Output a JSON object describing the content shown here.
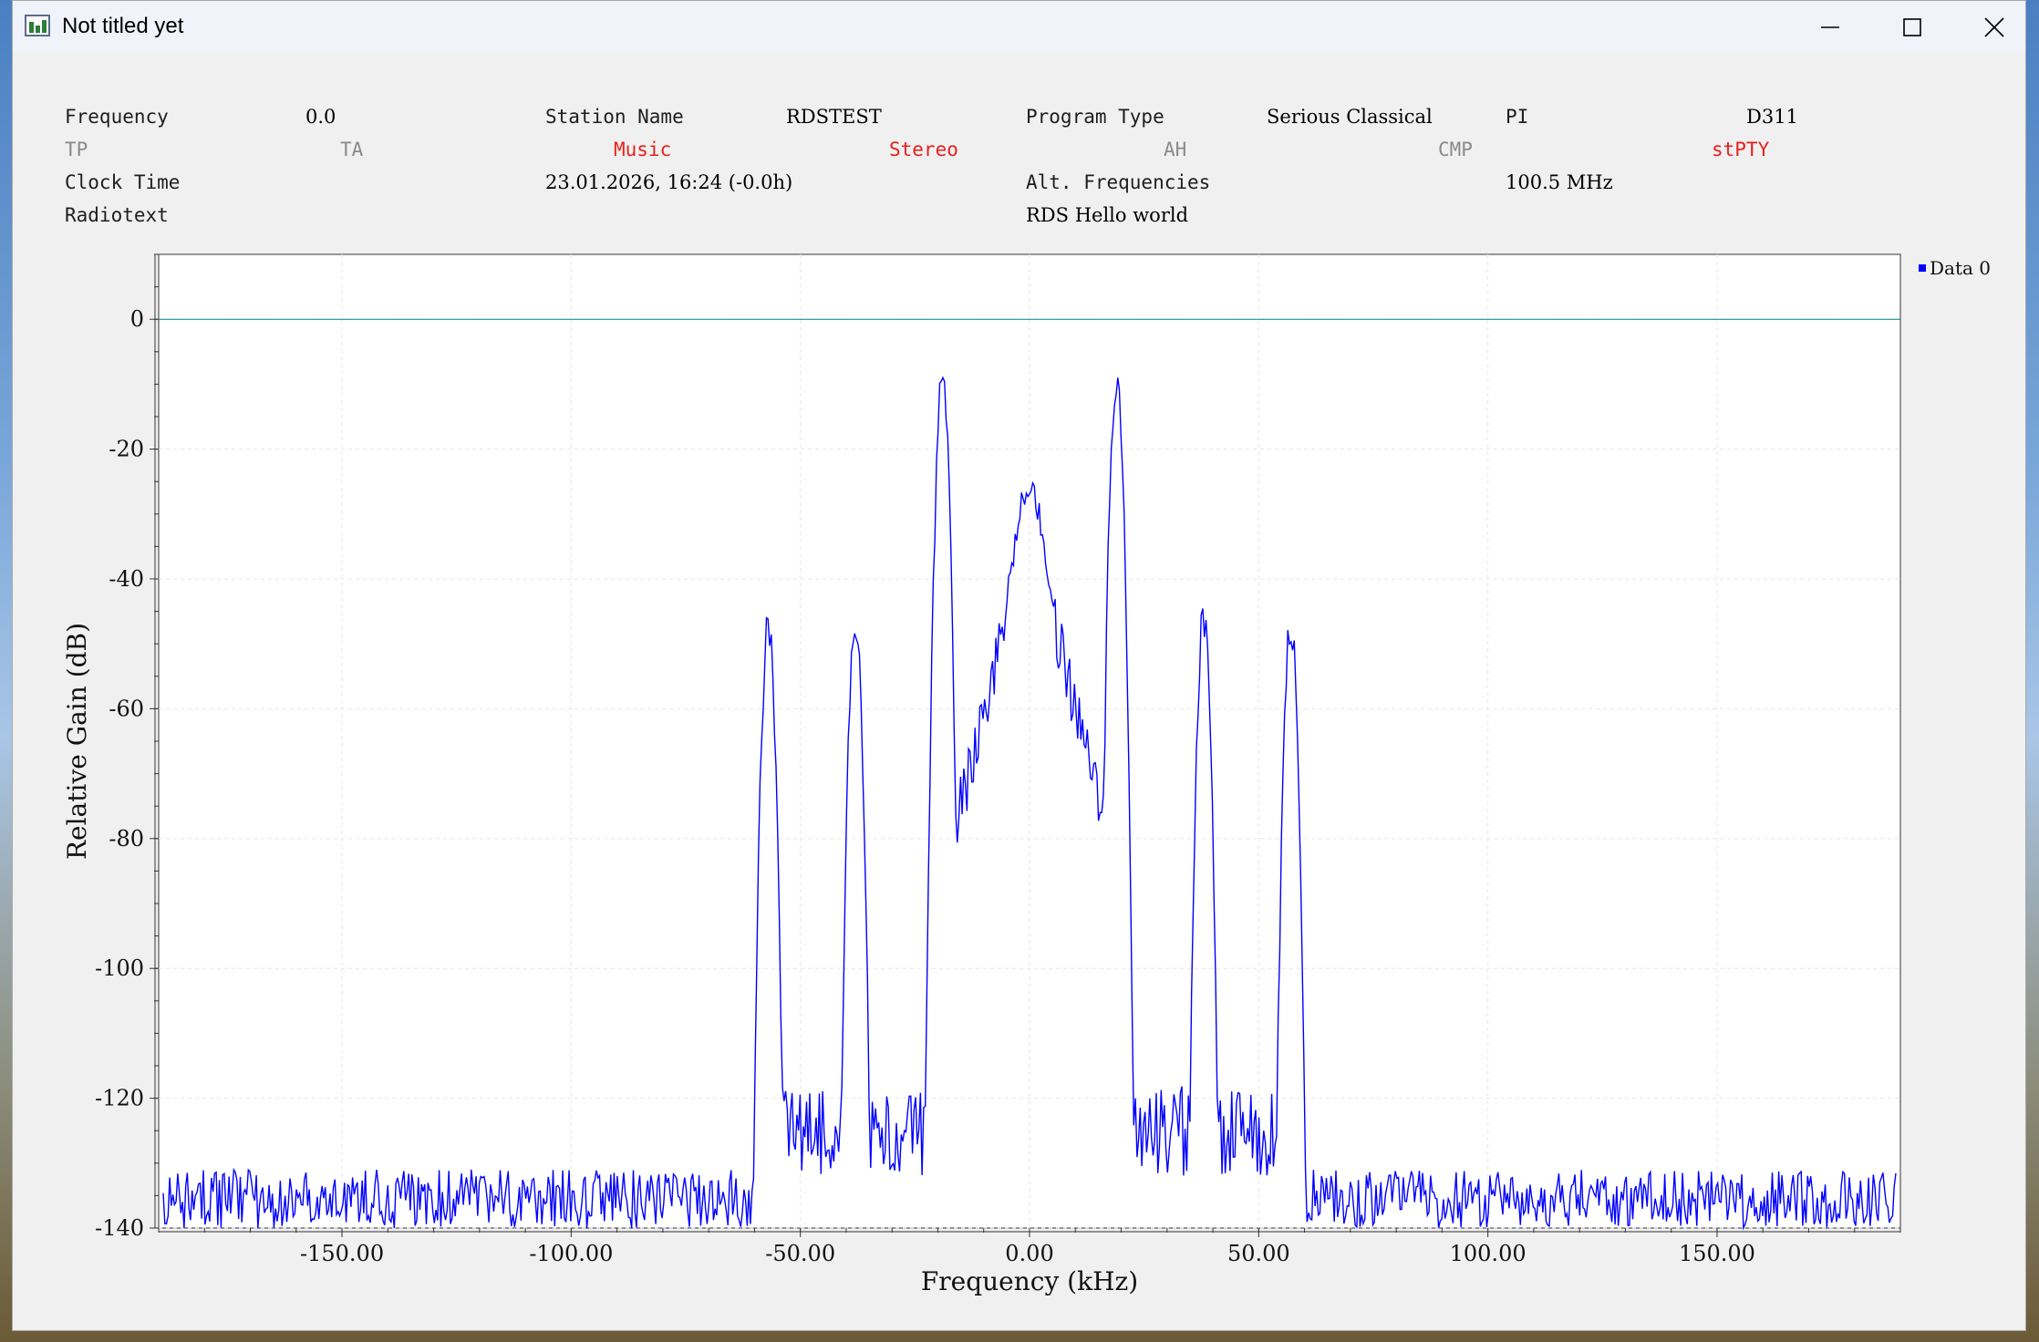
{
  "window": {
    "title": "Not titled yet"
  },
  "rds": {
    "frequency_label": "Frequency",
    "frequency_value": "0.0",
    "station_name_label": "Station Name",
    "station_name_value": "RDSTEST",
    "program_type_label": "Program Type",
    "program_type_value": "Serious Classical",
    "pi_label": "PI",
    "pi_value": "D311",
    "tp": "TP",
    "ta": "TA",
    "music": "Music",
    "stereo": "Stereo",
    "ah": "AH",
    "cmp": "CMP",
    "stpty": "stPTY",
    "clock_label": "Clock Time",
    "clock_value": "23.01.2026, 16:24 (-0.0h)",
    "alt_freq_label": "Alt. Frequencies",
    "alt_freq_value": "100.5 MHz",
    "radiotext_label": "Radiotext",
    "radiotext_value": "RDS Hello world"
  },
  "colors": {
    "active_flag": "#e8201c",
    "inactive_flag": "#8a8a8a",
    "trace": "#0000ff",
    "reference_line": "#008080"
  },
  "chart_data": {
    "type": "line",
    "xlabel": "Frequency (kHz)",
    "ylabel": "Relative Gain (dB)",
    "xlim": [
      -190,
      190
    ],
    "ylim": [
      -140,
      10
    ],
    "xticks": [
      "-150.00",
      "-100.00",
      "-50.00",
      "0.00",
      "50.00",
      "100.00",
      "150.00"
    ],
    "xtick_values": [
      -150,
      -100,
      -50,
      0,
      50,
      100,
      150
    ],
    "yticks": [
      "0",
      "-20",
      "-40",
      "-60",
      "-80",
      "-100",
      "-120",
      "-140"
    ],
    "ytick_values": [
      0,
      -20,
      -40,
      -60,
      -80,
      -100,
      -120,
      -140
    ],
    "grid": true,
    "legend": "top-right",
    "reference_line_y": 0,
    "series": [
      {
        "name": "Data 0",
        "color": "#0000ff",
        "peaks": [
          {
            "x": -57,
            "y": -47
          },
          {
            "x": -38,
            "y": -46
          },
          {
            "x": -19,
            "y": -9
          },
          {
            "x": 0,
            "y": -27
          },
          {
            "x": 19,
            "y": -9
          },
          {
            "x": 38,
            "y": -46
          },
          {
            "x": 57,
            "y": -47
          }
        ],
        "noise_floor": -135
      }
    ]
  }
}
